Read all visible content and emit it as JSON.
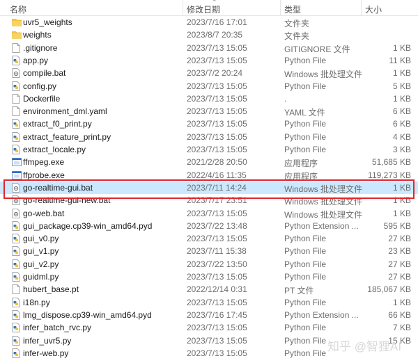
{
  "header": {
    "name": "名称",
    "date": "修改日期",
    "type": "类型",
    "size": "大小"
  },
  "colors": {
    "folder": "#f4c542",
    "selected": "#cce8ff",
    "highlight_box": "#e0262d"
  },
  "files": [
    {
      "name": "uvr5_weights",
      "date": "2023/7/16 17:01",
      "type": "文件夹",
      "size": "",
      "icon": "folder-icon"
    },
    {
      "name": "weights",
      "date": "2023/8/7 20:35",
      "type": "文件夹",
      "size": "",
      "icon": "folder-icon"
    },
    {
      "name": ".gitignore",
      "date": "2023/7/13 15:05",
      "type": "GITIGNORE 文件",
      "size": "1 KB",
      "icon": "file-icon"
    },
    {
      "name": "app.py",
      "date": "2023/7/13 15:05",
      "type": "Python File",
      "size": "11 KB",
      "icon": "python-file-icon"
    },
    {
      "name": "compile.bat",
      "date": "2023/7/2 20:24",
      "type": "Windows 批处理文件",
      "size": "1 KB",
      "icon": "batch-file-icon"
    },
    {
      "name": "config.py",
      "date": "2023/7/13 15:05",
      "type": "Python File",
      "size": "5 KB",
      "icon": "python-file-icon"
    },
    {
      "name": "Dockerfile",
      "date": "2023/7/13 15:05",
      "type": ".",
      "size": "1 KB",
      "icon": "file-icon"
    },
    {
      "name": "environment_dml.yaml",
      "date": "2023/7/13 15:05",
      "type": "YAML 文件",
      "size": "6 KB",
      "icon": "file-icon"
    },
    {
      "name": "extract_f0_print.py",
      "date": "2023/7/13 15:05",
      "type": "Python File",
      "size": "6 KB",
      "icon": "python-file-icon"
    },
    {
      "name": "extract_feature_print.py",
      "date": "2023/7/13 15:05",
      "type": "Python File",
      "size": "4 KB",
      "icon": "python-file-icon"
    },
    {
      "name": "extract_locale.py",
      "date": "2023/7/13 15:05",
      "type": "Python File",
      "size": "3 KB",
      "icon": "python-file-icon"
    },
    {
      "name": "ffmpeg.exe",
      "date": "2021/2/28 20:50",
      "type": "应用程序",
      "size": "51,685 KB",
      "icon": "exe-icon"
    },
    {
      "name": "ffprobe.exe",
      "date": "2022/4/16 11:35",
      "type": "应用程序",
      "size": "119,273 KB",
      "icon": "exe-icon"
    },
    {
      "name": "go-realtime-gui.bat",
      "date": "2023/7/11 14:24",
      "type": "Windows 批处理文件",
      "size": "1 KB",
      "icon": "batch-file-icon",
      "selected": true
    },
    {
      "name": "go-realtime-gui-new.bat",
      "date": "2023/7/17 23:51",
      "type": "Windows 批处理文件",
      "size": "1 KB",
      "icon": "batch-file-icon"
    },
    {
      "name": "go-web.bat",
      "date": "2023/7/13 15:05",
      "type": "Windows 批处理文件",
      "size": "1 KB",
      "icon": "batch-file-icon"
    },
    {
      "name": "gui_package.cp39-win_amd64.pyd",
      "date": "2023/7/22 13:48",
      "type": "Python Extension ...",
      "size": "595 KB",
      "icon": "python-file-icon"
    },
    {
      "name": "gui_v0.py",
      "date": "2023/7/13 15:05",
      "type": "Python File",
      "size": "27 KB",
      "icon": "python-file-icon"
    },
    {
      "name": "gui_v1.py",
      "date": "2023/7/11 15:38",
      "type": "Python File",
      "size": "23 KB",
      "icon": "python-file-icon"
    },
    {
      "name": "gui_v2.py",
      "date": "2023/7/22 13:50",
      "type": "Python File",
      "size": "27 KB",
      "icon": "python-file-icon"
    },
    {
      "name": "guidml.py",
      "date": "2023/7/13 15:05",
      "type": "Python File",
      "size": "27 KB",
      "icon": "python-file-icon"
    },
    {
      "name": "hubert_base.pt",
      "date": "2022/12/14 0:31",
      "type": "PT 文件",
      "size": "185,067 KB",
      "icon": "file-icon"
    },
    {
      "name": "i18n.py",
      "date": "2023/7/13 15:05",
      "type": "Python File",
      "size": "1 KB",
      "icon": "python-file-icon"
    },
    {
      "name": "lmg_dispose.cp39-win_amd64.pyd",
      "date": "2023/7/16 17:45",
      "type": "Python Extension ...",
      "size": "66 KB",
      "icon": "python-file-icon"
    },
    {
      "name": "infer_batch_rvc.py",
      "date": "2023/7/13 15:05",
      "type": "Python File",
      "size": "7 KB",
      "icon": "python-file-icon"
    },
    {
      "name": "infer_uvr5.py",
      "date": "2023/7/13 15:05",
      "type": "Python File",
      "size": "15 KB",
      "icon": "python-file-icon"
    },
    {
      "name": "infer-web.py",
      "date": "2023/7/13 15:05",
      "type": "Python File",
      "size": "",
      "icon": "python-file-icon"
    }
  ],
  "watermark": "知乎 @智狸AI"
}
